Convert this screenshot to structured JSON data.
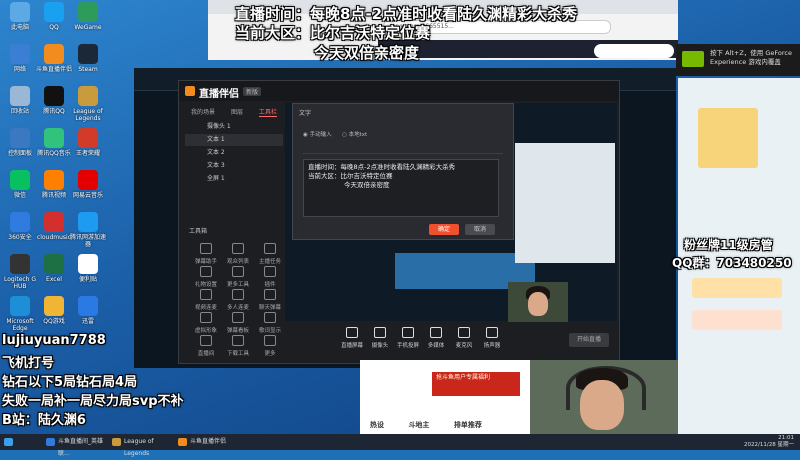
{
  "overlay": {
    "line1": "直播时间：每晚8点-2点准时收看陆久渊精彩大杀秀",
    "line2": "当前大区：比尔吉沃特定位赛",
    "line3": "今天双倍亲密度",
    "left1": "lujiuyuan7788",
    "left2": "飞机打号",
    "left3": "钻石以下5局钻石局4局",
    "left4": "失败一局补一局尽力局svp不补",
    "left5": "B站：陆久渊6",
    "fans": "粉丝牌11级房管",
    "qq": "QQ群：703480250"
  },
  "desktop_icons": [
    {
      "label": "此电脑",
      "color": "#5ca9e6"
    },
    {
      "label": "QQ",
      "color": "#1aa0f0"
    },
    {
      "label": "WeGame",
      "color": "#2d9b5a"
    },
    {
      "label": "网络",
      "color": "#3b7fd4"
    },
    {
      "label": "斗鱼直播伴侣",
      "color": "#f28c1e"
    },
    {
      "label": "Steam",
      "color": "#1b2838"
    },
    {
      "label": "回收站",
      "color": "#9ab7d6"
    },
    {
      "label": "腾讯QQ",
      "color": "#111111"
    },
    {
      "label": "League of Legends",
      "color": "#c89b3c"
    },
    {
      "label": "控制面板",
      "color": "#3a78c2"
    },
    {
      "label": "腾讯QQ音乐",
      "color": "#31c27c"
    },
    {
      "label": "王者荣耀",
      "color": "#d23a2a"
    },
    {
      "label": "微信",
      "color": "#07c160"
    },
    {
      "label": "腾讯视频",
      "color": "#ff7f00"
    },
    {
      "label": "网易云音乐",
      "color": "#e20000"
    },
    {
      "label": "360安全",
      "color": "#2f7be0"
    },
    {
      "label": "cloudmusic",
      "color": "#d32f2f"
    },
    {
      "label": "腾讯网游加速器",
      "color": "#1d9bf0"
    },
    {
      "label": "Logitech G HUB",
      "color": "#333333"
    },
    {
      "label": "Excel",
      "color": "#1d7044"
    },
    {
      "label": "便利贴",
      "color": "#ffffff"
    },
    {
      "label": "Microsoft Edge",
      "color": "#1c8fd6"
    },
    {
      "label": "QQ游戏",
      "color": "#f1b434"
    },
    {
      "label": "迅雷",
      "color": "#2b79e2"
    }
  ],
  "browser": {
    "address": "yuyu.com/3665515..."
  },
  "nvidia": {
    "text": "按下 Alt+Z，使用 GeForce Experience 游戏内覆盖"
  },
  "app": {
    "brand": "直播伴侣",
    "tabs": [
      "我的场景",
      "图层",
      "工具栏"
    ],
    "layers": [
      "摄像头 1",
      "文本 1",
      "文本 2",
      "文本 3",
      "全屏 1"
    ],
    "tools_label": "工具箱",
    "tools": [
      "弹幕助手",
      "观众列表",
      "主播任务",
      "礼物设置",
      "更多工具",
      "插件",
      "视频连麦",
      "多人连麦",
      "聊天弹幕",
      "虚拟形象",
      "弹幕看板",
      "歌词显示",
      "直播间",
      "下载工具",
      "更多"
    ],
    "bottom": [
      "直播屏幕",
      "摄像头",
      "手机投屏",
      "多媒体",
      "麦克风",
      "扬声器"
    ],
    "start": "开始直播"
  },
  "dialog": {
    "title": "文字",
    "opt1": "手动输入",
    "opt2": "本地txt",
    "lines": [
      "直播时间：每晚8点-2点准时收看陆久渊精彩大杀秀",
      "当前大区：比尔吉沃特定位赛",
      "今天双倍亲密度"
    ],
    "ok": "确定",
    "cancel": "取消"
  },
  "promo": {
    "banner": "抢斗鱼用户专属福利",
    "tabs": [
      "热设",
      "斗地主",
      "排单推荐"
    ]
  },
  "taskbar": {
    "items": [
      "斗鱼直播间_英雄联...",
      "League of Legends",
      "斗鱼直播伴侣"
    ],
    "time": "21:01",
    "date": "2022/11/28 星期一"
  }
}
